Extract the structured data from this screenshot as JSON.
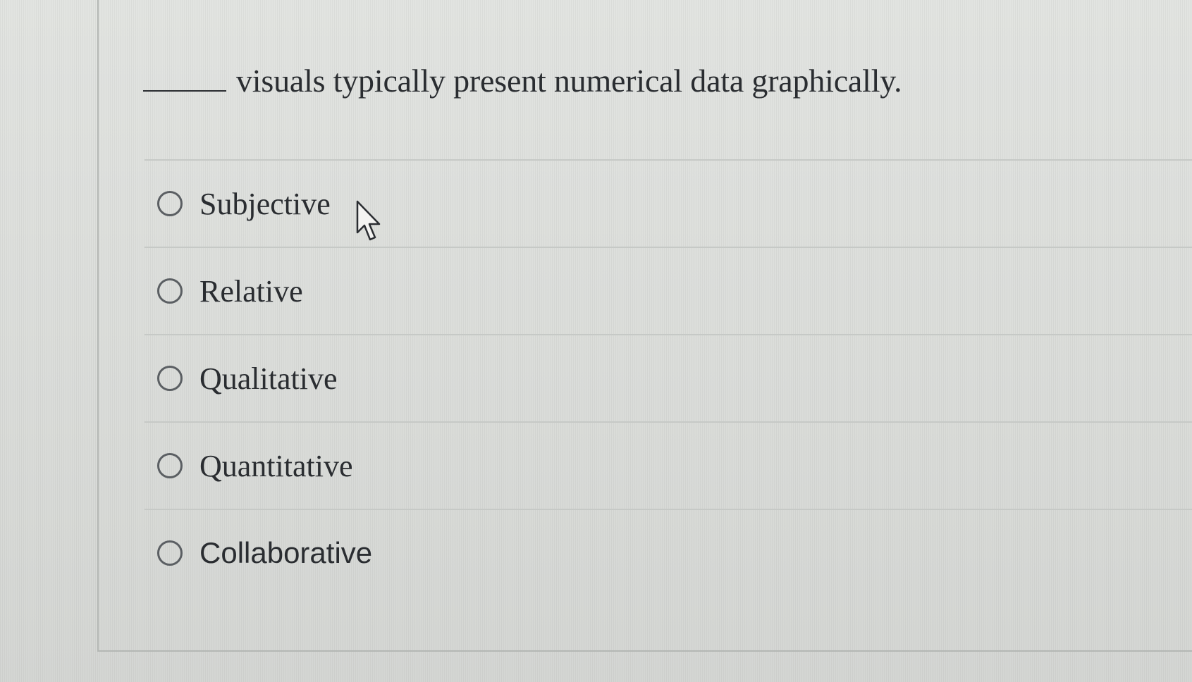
{
  "question": {
    "text": "visuals typically present numerical data graphically."
  },
  "options": [
    {
      "label": "Subjective",
      "selected": false
    },
    {
      "label": "Relative",
      "selected": false
    },
    {
      "label": "Qualitative",
      "selected": false
    },
    {
      "label": "Quantitative",
      "selected": false
    },
    {
      "label": "Collaborative",
      "selected": false
    }
  ],
  "icons": {
    "cursor": "mouse-pointer-icon",
    "radio": "radio-unselected-icon"
  }
}
